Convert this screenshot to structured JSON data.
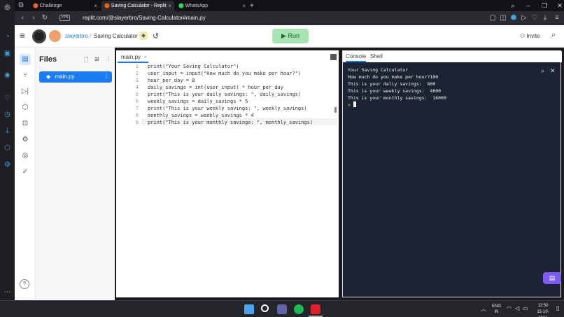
{
  "browser": {
    "tabs": [
      {
        "title": "Challenge"
      },
      {
        "title": "Saving Calculator - Replit"
      },
      {
        "title": "WhatsApp"
      }
    ],
    "new_tab": "+",
    "url": "replit.com/@slayerbro/Saving-Calculator#main.py",
    "vpn_badge": "VPN"
  },
  "replit": {
    "username": "slayerbro",
    "separator": "/",
    "repl_name": "Saving Calculator",
    "run_label": "Run",
    "invite_label": "Invite",
    "files_title": "Files",
    "file_name": "main.py",
    "help_label": "?"
  },
  "editor": {
    "tab_label": "main.py",
    "lines": [
      {
        "n": "1",
        "text": "print(\"Your Saving Calculator\")"
      },
      {
        "n": "2",
        "text": "user_input = input(\"How much do you make per hour?\")"
      },
      {
        "n": "3",
        "text": "hour_per_day = 8"
      },
      {
        "n": "4",
        "text": "daily_savings = int(user_input) * hour_per_day"
      },
      {
        "n": "5",
        "text": "print(\"This is your daily savings: \", daily_savings)"
      },
      {
        "n": "6",
        "text": "weekly_savings = daily_savings * 5"
      },
      {
        "n": "7",
        "text": "print(\"This is your weekly savings: \", weekly_savings)"
      },
      {
        "n": "8",
        "text": "monthly_savings = weekly_savings * 4"
      },
      {
        "n": "9",
        "text": "print(\"This is your monthly savings: \", monthly_savings)"
      }
    ]
  },
  "console": {
    "tab_console": "Console",
    "tab_shell": "Shell",
    "lines": [
      "Your Saving Calculator",
      "How much do you make per hour?100",
      "This is your daliy savings:  800",
      "This is your weekly savings:  4000",
      "This is your monthly savings:  16000"
    ],
    "prompt": ">"
  },
  "taskbar": {
    "lang_line1": "ENG",
    "lang_line2": "IN",
    "time": "12:50",
    "date": "15-10-2021"
  },
  "colors": {
    "accent": "#1a7cf2",
    "run_bg": "#a7e3b3",
    "console_bg": "#1c2333"
  }
}
